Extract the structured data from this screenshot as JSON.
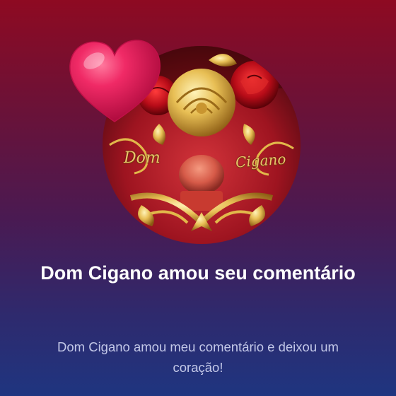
{
  "notification": {
    "avatar": {
      "word_left": "Dom",
      "word_right": "Cigano"
    },
    "reaction_icon": "heart-icon",
    "title": "Dom Cigano amou seu comentário",
    "message": "Dom Cigano amou meu comentário e deixou um coração!"
  },
  "colors": {
    "background_top": "#8e0a22",
    "background_bottom": "#1f3580",
    "heart": "#e8195a",
    "gold": "#e2b84a"
  }
}
